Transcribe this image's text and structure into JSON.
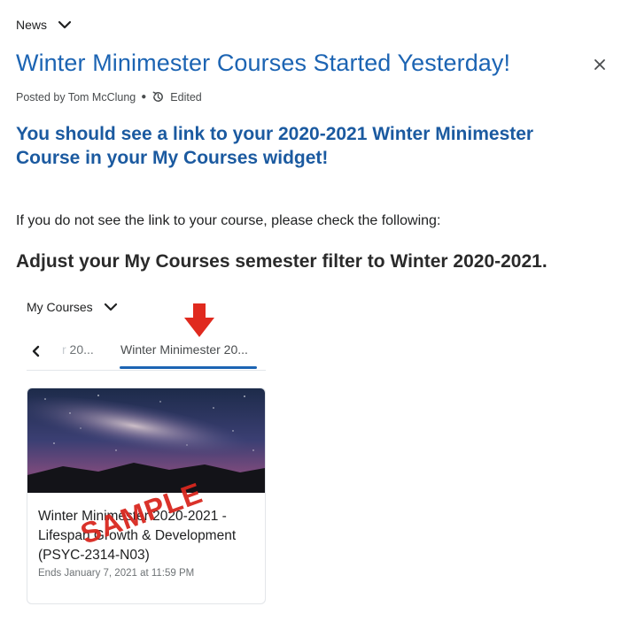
{
  "header": {
    "news_label": "News"
  },
  "article": {
    "title": "Winter Minimester Courses Started Yesterday!",
    "posted_by": "Posted by Tom McClung",
    "edited_label": "Edited",
    "headline": "You should see a link to your 2020-2021 Winter Minimester Course in your My Courses widget!",
    "intro": "If you do not see the link to your course, please check the following:",
    "adjust_heading": "Adjust your My Courses semester filter to Winter 2020-2021."
  },
  "widget": {
    "title": "My Courses",
    "tabs": [
      {
        "label_fade": "r",
        "label": " 20..."
      },
      {
        "label": "Winter Minimester 20..."
      }
    ],
    "course": {
      "name": "Winter Minimester 2020-2021 - Lifespan Growth & Development (PSYC-2314-N03)",
      "ends": "Ends January 7, 2021 at 11:59 PM",
      "watermark": "SAMPLE"
    }
  },
  "colors": {
    "link_blue": "#1c64b3",
    "arrow_red": "#e02a1f",
    "watermark_red": "#d9281f"
  },
  "icons": [
    "chevron-down-icon",
    "close-icon",
    "edited-icon",
    "chevron-left-icon",
    "red-arrow-down-icon"
  ]
}
